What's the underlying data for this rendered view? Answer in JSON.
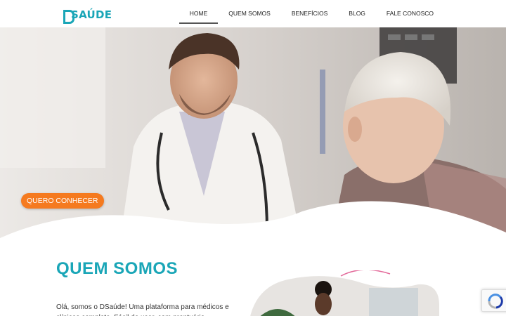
{
  "brand": {
    "name": "SAÚDE",
    "accent": "#1aa6b7"
  },
  "nav": {
    "items": [
      {
        "label": "HOME",
        "active": true
      },
      {
        "label": "QUEM SOMOS",
        "active": false
      },
      {
        "label": "BENEFÍCIOS",
        "active": false
      },
      {
        "label": "BLOG",
        "active": false
      },
      {
        "label": "FALE CONOSCO",
        "active": false
      }
    ]
  },
  "hero": {
    "cta_label": "QUERO CONHECER",
    "cta_color": "#f57a1f"
  },
  "about": {
    "title": "QUEM SOMOS",
    "text": "Olá, somos o DSaúde! Uma  plataforma para médicos e clínicas completa. Fácil de usar, com prontuário"
  },
  "recaptcha": {
    "icon": "recaptcha-icon"
  }
}
